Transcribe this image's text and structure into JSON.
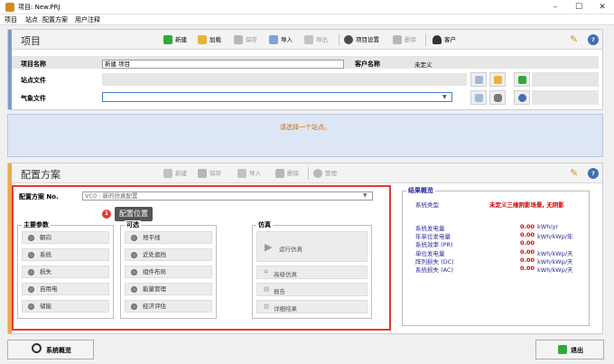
{
  "window": {
    "title": "项目: New.PRJ"
  },
  "menu": [
    "项目",
    "站点",
    "配置方案",
    "用户注释"
  ],
  "project": {
    "title": "项目",
    "toolbar": {
      "new": "新建",
      "load": "加载",
      "save": "保存",
      "import": "导入",
      "export": "导出",
      "settings": "项目设置",
      "delete": "删除",
      "client": "客户"
    },
    "name_label": "项目名称",
    "name_value": "新建 项目",
    "client_label": "客户名称",
    "client_value": "未定义",
    "site_label": "站点文件",
    "meteo_label": "气象文件"
  },
  "notice": {
    "text": "请选择一个站点。"
  },
  "config": {
    "title": "配置方案",
    "toolbar": {
      "new": "新建",
      "save": "保存",
      "import": "导入",
      "delete": "删除",
      "manage": "管理"
    },
    "variant_label": "配置方案 No.",
    "variant_value": "VC0    : 新的仿真配置",
    "tooltip": {
      "badge": "1",
      "text": "配置位置"
    },
    "main_params": {
      "title": "主要参数",
      "items": [
        "朝向",
        "系统",
        "损失",
        "自用电",
        "储能"
      ]
    },
    "optional": {
      "title": "可选",
      "items": [
        "地平线",
        "近处遮挡",
        "组件布局",
        "能量管理",
        "经济评估"
      ]
    },
    "simulation": {
      "title": "仿真",
      "run": "运行仿真",
      "advanced": "高级仿真",
      "report": "报告",
      "details": "详细结果"
    }
  },
  "results": {
    "title": "结果概览",
    "system_type_label": "系统类型",
    "system_type_value": "未定义三维阴影场景, 无阴影",
    "rows": [
      {
        "label": "系统发电量",
        "value": "0.00",
        "unit": "kWh/yr"
      },
      {
        "label": "年单位发电量",
        "value": "0.00",
        "unit": "kWh/kWp/年"
      },
      {
        "label": "系统效率 (PR)",
        "value": "0.00",
        "unit": ""
      },
      {
        "label": "单位发电量",
        "value": "0.00",
        "unit": "kWh/kWp/天"
      },
      {
        "label": "阵列损失 (DC)",
        "value": "0.00",
        "unit": "kWh/kWp/天"
      },
      {
        "label": "系统损失 (AC)",
        "value": "0.00",
        "unit": "kWh/kWp/天"
      }
    ]
  },
  "footer": {
    "overview": "系统概览",
    "exit": "退出"
  },
  "colors": {
    "accent_blue": "#7f9bd0",
    "accent_orange": "#f0a848",
    "highlight_red": "#e53935",
    "notice_bg": "#dde6f5",
    "notice_text": "#d06a00"
  }
}
